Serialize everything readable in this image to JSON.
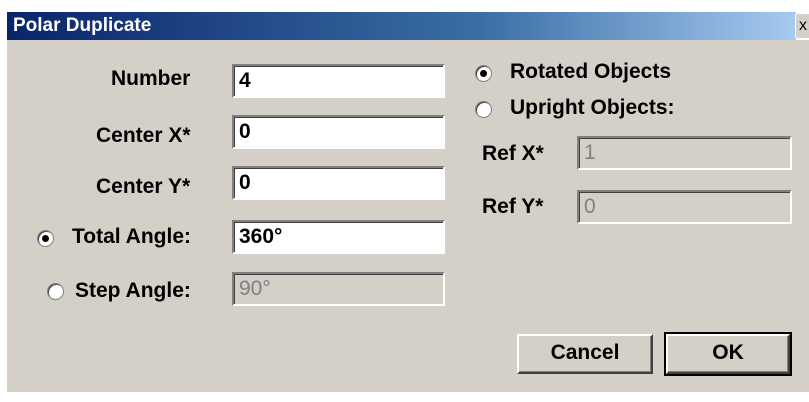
{
  "window": {
    "title": "Polar Duplicate",
    "close_glyph": "x"
  },
  "fields": {
    "number": {
      "label": "Number",
      "value": "4"
    },
    "center_x": {
      "label": "Center X*",
      "value": "0"
    },
    "center_y": {
      "label": "Center Y*",
      "value": "0"
    },
    "total_angle": {
      "label": "Total Angle:",
      "value": "360°",
      "selected": true
    },
    "step_angle": {
      "label": "Step Angle:",
      "value": "90°",
      "selected": false
    }
  },
  "orientation": {
    "rotated_label": "Rotated Objects",
    "rotated_selected": true,
    "upright_label": "Upright Objects:",
    "upright_selected": false,
    "ref_x": {
      "label": "Ref X*",
      "value": "1"
    },
    "ref_y": {
      "label": "Ref Y*",
      "value": "0"
    }
  },
  "buttons": {
    "cancel": "Cancel",
    "ok": "OK"
  }
}
